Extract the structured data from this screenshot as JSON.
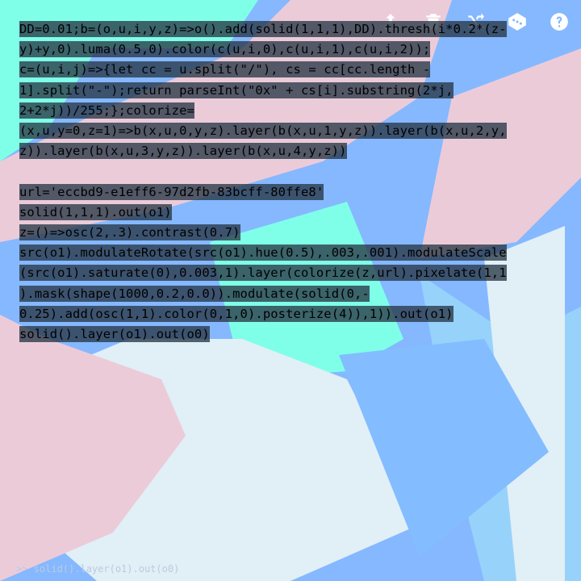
{
  "toolbar": {
    "icons": [
      "upload-icon",
      "trash-icon",
      "shuffle-icon",
      "dice-icon",
      "help-icon"
    ]
  },
  "editor": {
    "lines": [
      "DD=0.01;b=(o,u,i,y,z)=>o().add(solid(1,1,1),DD).thresh(i*0.2*(z-",
      "y)+y,0).luma(0.5,0).color(c(u,i,0),c(u,i,1),c(u,i,2));",
      "c=(u,i,j)=>{let cc = u.split(\"/\"), cs = cc[cc.length -",
      "1].split(\"-\");return parseInt(\"0x\" + cs[i].substring(2*j,",
      "2+2*j))/255;};colorize=",
      "(x,u,y=0,z=1)=>b(x,u,0,y,z).layer(b(x,u,1,y,z)).layer(b(x,u,2,y,",
      "z)).layer(b(x,u,3,y,z)).layer(b(x,u,4,y,z))",
      "",
      "url='eccbd9-e1eff6-97d2fb-83bcff-80ffe8'",
      "solid(1,1,1).out(o1)",
      "z=()=>osc(2,.3).contrast(0.7)",
      "src(o1).modulateRotate(src(o1).hue(0.5),.003,.001).modulateScale",
      "(src(o1).saturate(0),0.003,1).layer(colorize(z,url).pixelate(1,1",
      ").mask(shape(1000,0.2,0.0)).modulate(solid(0,-",
      "0.25).add(osc(1,1).color(0,1,0).posterize(4)),1)).out(o1)",
      "solid().layer(o1).out(o0)"
    ]
  },
  "console": {
    "text": ">> solid().layer(o1).out(o0)"
  },
  "colors": {
    "background": "#85b8ff",
    "pink": "#eccbd9",
    "light": "#e1eff6",
    "blue": "#97d2fb",
    "mid": "#83bcff",
    "mint": "#80ffe8"
  }
}
